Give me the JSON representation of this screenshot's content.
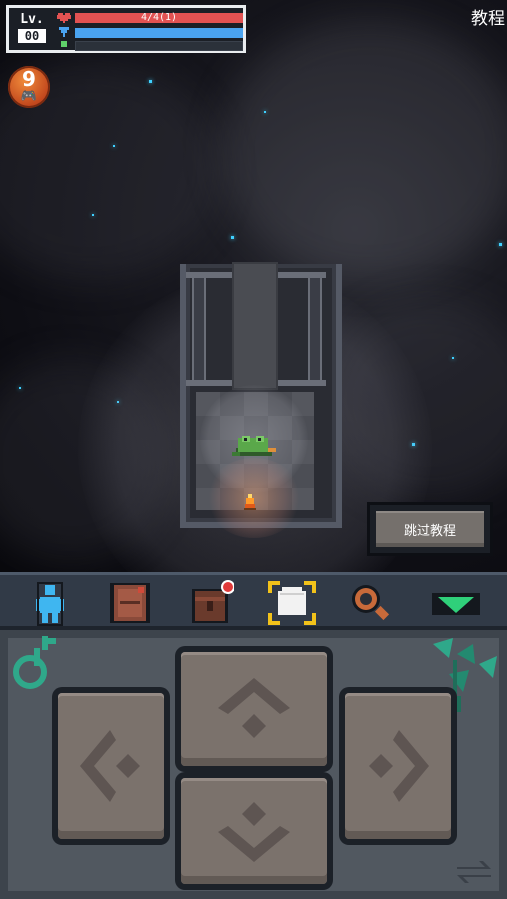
{
  "hud": {
    "level_label": "Lv.",
    "level_value": "00",
    "hp_text": "4/4(1)",
    "tutorial_title": "教程",
    "gamepad_badge_count": "9",
    "colors": {
      "hp": "#e25252",
      "mp": "#4aa3f0",
      "xp": "#2b313a"
    }
  },
  "skip_button": {
    "label": "跳过教程"
  },
  "toolbar": {
    "items": [
      {
        "icon": "character-icon"
      },
      {
        "icon": "spellbook-icon"
      },
      {
        "icon": "backpack-icon",
        "notification": true
      },
      {
        "icon": "hand-select-icon",
        "selected": true
      },
      {
        "icon": "magnifier-icon"
      },
      {
        "icon": "collapse-arrow-icon"
      }
    ]
  },
  "dpad": {
    "up": "arrow-up-icon",
    "down": "arrow-down-icon",
    "left": "arrow-left-icon",
    "right": "arrow-right-icon",
    "swap": "swap-icon"
  }
}
